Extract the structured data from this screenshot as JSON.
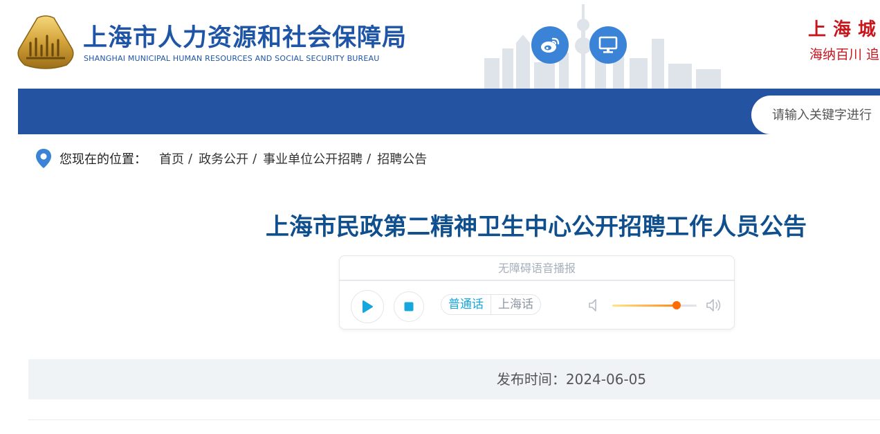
{
  "header": {
    "brand_cn": "上海市人力资源和社会保障局",
    "brand_en": "SHANGHAI MUNICIPAL HUMAN RESOURCES AND SOCIAL SECURITY BUREAU",
    "logo_icon": "bureau-emblem-icon",
    "buttons": [
      {
        "icon": "weibo-icon"
      },
      {
        "icon": "desktop-monitor-icon"
      }
    ],
    "slogan_line1": "上海城市",
    "slogan_line2": "海纳百川 追"
  },
  "search": {
    "placeholder": "请输入关键字进行"
  },
  "breadcrumb": {
    "label": "您现在的位置：",
    "items": [
      "首页",
      "政务公开",
      "事业单位公开招聘",
      "招聘公告"
    ],
    "separator": "/"
  },
  "article": {
    "title": "上海市民政第二精神卫生中心公开招聘工作人员公告",
    "publish_time": "发布时间：2024-06-05"
  },
  "player": {
    "title": "无障碍语音播报",
    "languages": [
      "普通话",
      "上海话"
    ],
    "selected_language": "普通话",
    "volume": 0.76
  },
  "colors": {
    "brand_blue": "#1f55a6",
    "nav_blue": "#2453a2",
    "title_blue": "#0f4f8e",
    "slogan_red": "#c8161d",
    "accent_cyan": "#16a8dd",
    "volume_orange": "#ff6d00"
  }
}
